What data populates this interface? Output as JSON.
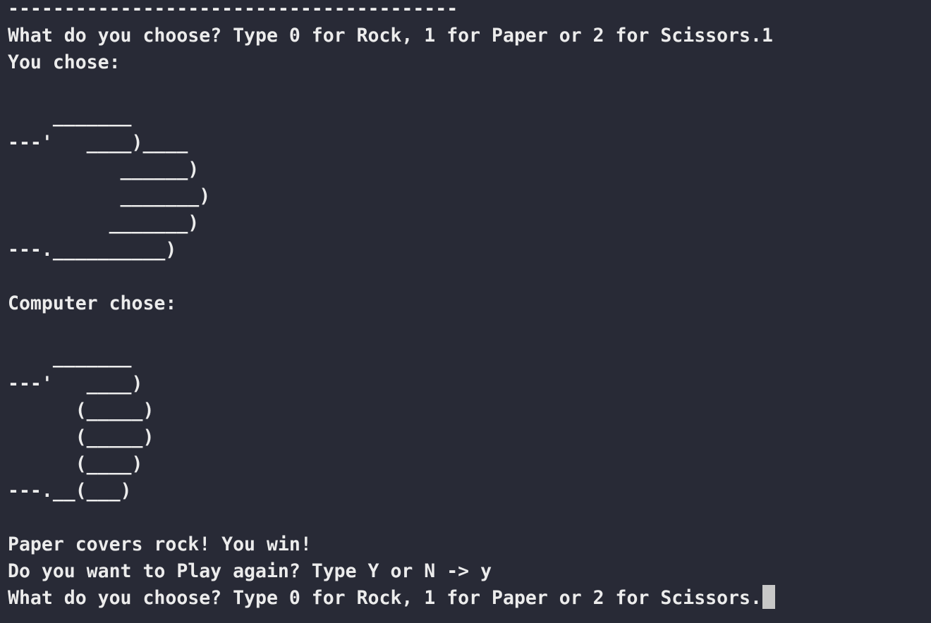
{
  "terminal": {
    "lines": [
      "----------------------------------------",
      "What do you choose? Type 0 for Rock, 1 for Paper or 2 for Scissors.1",
      "You chose:",
      "",
      "    _______",
      "---'   ____)____",
      "          ______)",
      "          _______)",
      "         _______)",
      "---.__________)",
      "",
      "Computer chose:",
      "",
      "    _______",
      "---'   ____)",
      "      (_____)",
      "      (_____)",
      "      (____)",
      "---.__(___)",
      "",
      "Paper covers rock! You win!",
      "Do you want to Play again? Type Y or N -> y",
      "What do you choose? Type 0 for Rock, 1 for Paper or 2 for Scissors."
    ]
  }
}
